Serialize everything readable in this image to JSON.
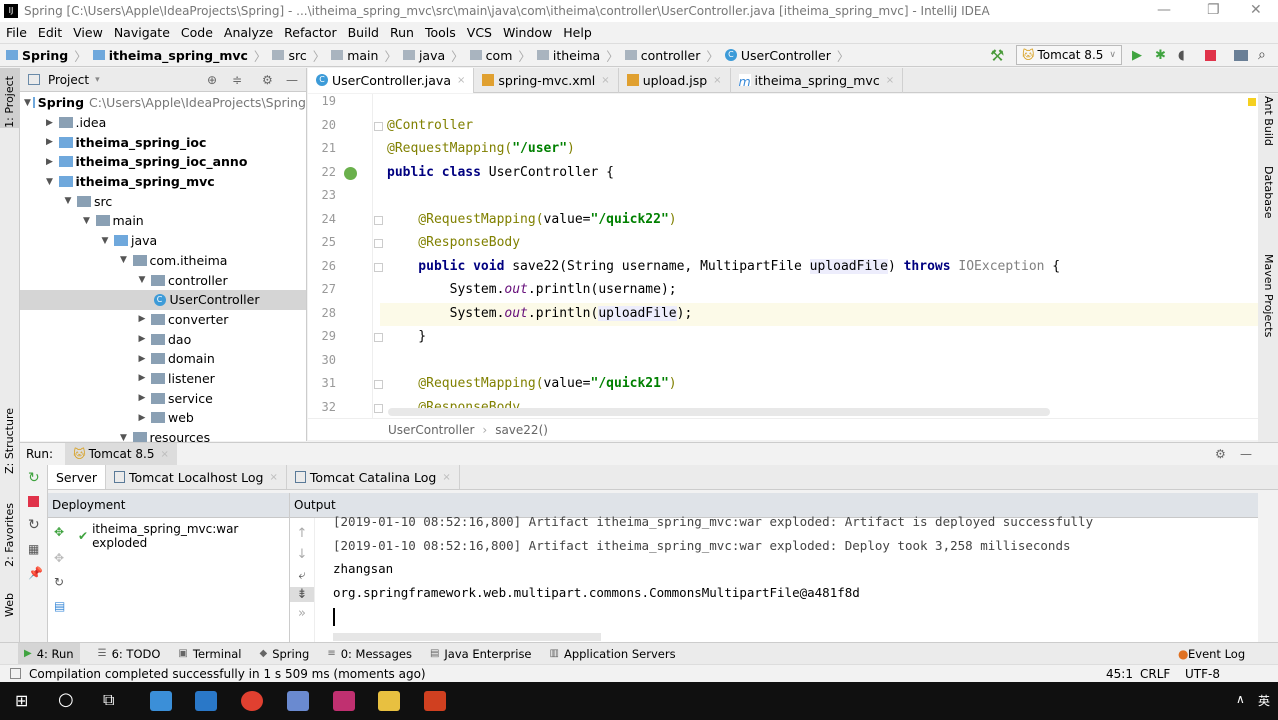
{
  "window": {
    "title": "Spring [C:\\Users\\Apple\\IdeaProjects\\Spring] - ...\\itheima_spring_mvc\\src\\main\\java\\com\\itheima\\controller\\UserController.java [itheima_spring_mvc] - IntelliJ IDEA",
    "logo": "IJ"
  },
  "menu": [
    "File",
    "Edit",
    "View",
    "Navigate",
    "Code",
    "Analyze",
    "Refactor",
    "Build",
    "Run",
    "Tools",
    "VCS",
    "Window",
    "Help"
  ],
  "navbar": {
    "crumbs": [
      "Spring",
      "itheima_spring_mvc",
      "src",
      "main",
      "java",
      "com",
      "itheima",
      "controller",
      "UserController"
    ],
    "run_config": "Tomcat 8.5"
  },
  "project": {
    "title": "Project",
    "tree": [
      {
        "label": "Spring",
        "path": "C:\\Users\\Apple\\IdeaProjects\\Spring",
        "level": 0,
        "open": true,
        "bold": true,
        "icon": "module"
      },
      {
        "label": ".idea",
        "level": 1,
        "open": false,
        "icon": "folder"
      },
      {
        "label": "itheima_spring_ioc",
        "level": 1,
        "open": false,
        "bold": true,
        "icon": "module"
      },
      {
        "label": "itheima_spring_ioc_anno",
        "level": 1,
        "open": false,
        "bold": true,
        "icon": "module"
      },
      {
        "label": "itheima_spring_mvc",
        "level": 1,
        "open": true,
        "bold": true,
        "icon": "module"
      },
      {
        "label": "src",
        "level": 2,
        "open": true,
        "icon": "folder"
      },
      {
        "label": "main",
        "level": 3,
        "open": true,
        "icon": "folder"
      },
      {
        "label": "java",
        "level": 4,
        "open": true,
        "icon": "source"
      },
      {
        "label": "com.itheima",
        "level": 5,
        "open": true,
        "icon": "folder"
      },
      {
        "label": "controller",
        "level": 6,
        "open": true,
        "icon": "folder"
      },
      {
        "label": "UserController",
        "level": 7,
        "icon": "class",
        "selected": true
      },
      {
        "label": "converter",
        "level": 6,
        "open": false,
        "icon": "folder"
      },
      {
        "label": "dao",
        "level": 6,
        "open": false,
        "icon": "folder"
      },
      {
        "label": "domain",
        "level": 6,
        "open": false,
        "icon": "folder"
      },
      {
        "label": "listener",
        "level": 6,
        "open": false,
        "icon": "folder"
      },
      {
        "label": "service",
        "level": 6,
        "open": false,
        "icon": "folder"
      },
      {
        "label": "web",
        "level": 6,
        "open": false,
        "icon": "folder"
      },
      {
        "label": "resources",
        "level": 5,
        "open": true,
        "icon": "folder"
      }
    ]
  },
  "editor": {
    "tabs": [
      {
        "label": "UserController.java",
        "active": true
      },
      {
        "label": "spring-mvc.xml"
      },
      {
        "label": "upload.jsp"
      },
      {
        "label": "itheima_spring_mvc"
      }
    ],
    "lines": [
      {
        "n": "19",
        "tokens": []
      },
      {
        "n": "20",
        "tokens": [
          {
            "t": "@Controller",
            "c": "a"
          }
        ]
      },
      {
        "n": "21",
        "tokens": [
          {
            "t": "@RequestMapping(",
            "c": "a"
          },
          {
            "t": "\"/user\"",
            "c": "s"
          },
          {
            "t": ")",
            "c": "a"
          }
        ]
      },
      {
        "n": "22",
        "tokens": [
          {
            "t": "public class ",
            "c": "k"
          },
          {
            "t": "UserController {",
            "c": ""
          }
        ]
      },
      {
        "n": "23",
        "tokens": []
      },
      {
        "n": "24",
        "tokens": [
          {
            "t": "    @RequestMapping(",
            "c": "a"
          },
          {
            "t": "value=",
            "c": ""
          },
          {
            "t": "\"/quick22\"",
            "c": "s"
          },
          {
            "t": ")",
            "c": "a"
          }
        ]
      },
      {
        "n": "25",
        "tokens": [
          {
            "t": "    @ResponseBody",
            "c": "a"
          }
        ]
      },
      {
        "n": "26",
        "tokens": [
          {
            "t": "    public void ",
            "c": "k"
          },
          {
            "t": "save22(String username, MultipartFile ",
            "c": ""
          },
          {
            "t": "uploadFile",
            "c": "hl"
          },
          {
            "t": ") ",
            "c": ""
          },
          {
            "t": "throws ",
            "c": "k"
          },
          {
            "t": "IOException",
            "c": "g"
          },
          {
            "t": " {",
            "c": ""
          }
        ]
      },
      {
        "n": "27",
        "tokens": [
          {
            "t": "        System.",
            "c": ""
          },
          {
            "t": "out",
            "c": "st"
          },
          {
            "t": ".println(username);",
            "c": ""
          }
        ]
      },
      {
        "n": "28",
        "tokens": [
          {
            "t": "        System.",
            "c": ""
          },
          {
            "t": "out",
            "c": "st"
          },
          {
            "t": ".println(",
            "c": ""
          },
          {
            "t": "uploadFile",
            "c": "hl"
          },
          {
            "t": ");",
            "c": ""
          }
        ],
        "current": true
      },
      {
        "n": "29",
        "tokens": [
          {
            "t": "    }",
            "c": ""
          }
        ]
      },
      {
        "n": "30",
        "tokens": []
      },
      {
        "n": "31",
        "tokens": [
          {
            "t": "    @RequestMapping(",
            "c": "a"
          },
          {
            "t": "value=",
            "c": ""
          },
          {
            "t": "\"/quick21\"",
            "c": "s"
          },
          {
            "t": ")",
            "c": "a"
          }
        ]
      },
      {
        "n": "32",
        "tokens": [
          {
            "t": "    @ResponseBody",
            "c": "a"
          }
        ]
      }
    ],
    "breadcrumb": [
      "UserController",
      "save22()"
    ]
  },
  "right_stripe": [
    "Ant Build",
    "Database",
    "Maven Projects"
  ],
  "left_stripe": [
    "1: Project",
    "Z: Structure",
    "2: Favorites",
    "Web"
  ],
  "run": {
    "label": "Run:",
    "config": "Tomcat 8.5",
    "tabs": [
      "Server",
      "Tomcat Localhost Log",
      "Tomcat Catalina Log"
    ],
    "deployment_header": "Deployment",
    "output_header": "Output",
    "deployment": "itheima_spring_mvc:war exploded",
    "output": [
      "[2019-01-10 08:52:16,800] Artifact itheima_spring_mvc:war exploded: Artifact is deployed successfully",
      "[2019-01-10 08:52:16,800] Artifact itheima_spring_mvc:war exploded: Deploy took 3,258 milliseconds",
      "zhangsan",
      "org.springframework.web.multipart.commons.CommonsMultipartFile@a481f8d"
    ]
  },
  "tool_tabs": [
    "4: Run",
    "6: TODO",
    "Terminal",
    "Spring",
    "0: Messages",
    "Java Enterprise",
    "Application Servers"
  ],
  "event_log": "Event Log",
  "status": {
    "message": "Compilation completed successfully in 1 s 509 ms (moments ago)",
    "position": "45:1",
    "line_sep": "CRLF",
    "encoding": "UTF-8"
  },
  "taskbar": {
    "lang": "英"
  }
}
